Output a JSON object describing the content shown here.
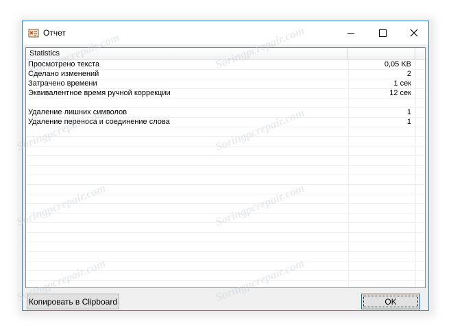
{
  "window": {
    "title": "Отчет"
  },
  "list": {
    "header": {
      "col1": "Statistics",
      "col2": ""
    },
    "rows": [
      {
        "name": "Просмотрено текста",
        "value": "0,05 KB"
      },
      {
        "name": "Сделано изменений",
        "value": "2"
      },
      {
        "name": "Затрачено времени",
        "value": "1 сек"
      },
      {
        "name": "Эквивалентное время ручной коррекции",
        "value": "12 сек"
      },
      {
        "name": "",
        "value": ""
      },
      {
        "name": "Удаление лишних символов",
        "value": "1"
      },
      {
        "name": "Удаление переноса и соединение слова",
        "value": "1"
      }
    ]
  },
  "buttons": {
    "copy": "Копировать в Clipboard",
    "ok": "OK"
  },
  "watermark": "Soringpcrepair.com",
  "colors": {
    "accent": "#3c7fd6",
    "focus": "#0078d7"
  }
}
